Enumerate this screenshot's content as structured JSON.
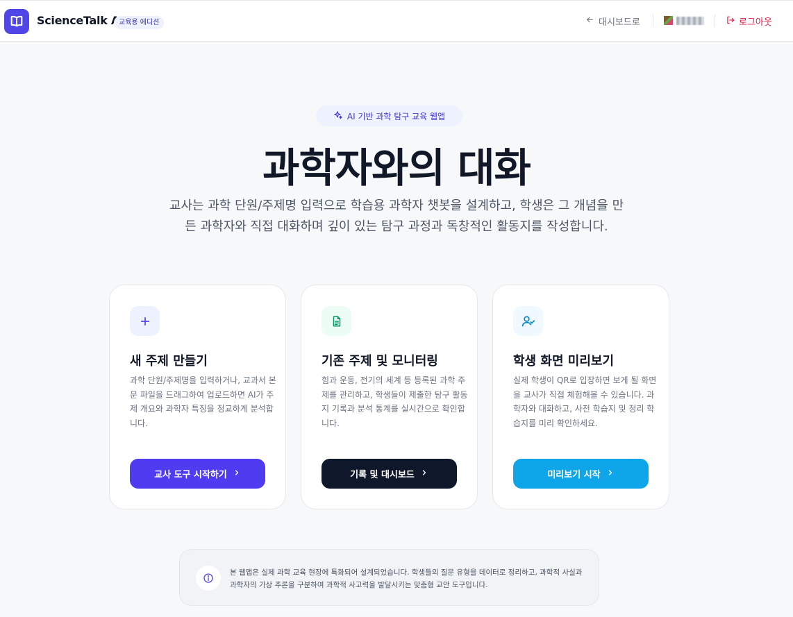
{
  "header": {
    "app_title": "ScienceTalk AI",
    "edition_badge": "교육용 에디션",
    "dashboard_link": "대시보드로",
    "logout": "로그아웃"
  },
  "hero": {
    "pill": "AI 기반 과학 탐구 교육 웹앱",
    "title": "과학자와의 대화",
    "description": "교사는 과학 단원/주제명 입력으로 학습용 과학자 챗봇을 설계하고, 학생은 그 개념을 만든 과학자와 직접 대화하며 깊이 있는 탐구 과정과 독창적인 활동지를 작성합니다."
  },
  "cards": [
    {
      "icon": "plus-icon",
      "title": "새 주제 만들기",
      "description": "과학 단원/주제명을 입력하거나, 교과서 본문 파일을 드래그하여 업로드하면 AI가 주제 개요와 과학자 특징을 정교하게 분석합니다.",
      "button": "교사 도구 시작하기",
      "button_color": "#4f3cf0",
      "icon_bg": "#eef2ff",
      "icon_color": "#4f46e5"
    },
    {
      "icon": "document-icon",
      "title": "기존 주제 및 모니터링",
      "description": "힘과 운동, 전기의 세계 등 등록된 과학 주제를 관리하고, 학생들이 제출한 탐구 활동지 기록과 분석 통계를 실시간으로 확인합니다.",
      "button": "기록 및 대시보드",
      "button_color": "#0f172a",
      "icon_bg": "#ecfdf5",
      "icon_color": "#059669"
    },
    {
      "icon": "user-check-icon",
      "title": "학생 화면 미리보기",
      "description": "실제 학생이 QR로 입장하면 보게 될 화면을 교사가 직접 체험해볼 수 있습니다. 과학자와 대화하고, 사전 학습지 및 정리 학습지를 미리 확인하세요.",
      "button": "미리보기 시작",
      "button_color": "#0ea5e9",
      "icon_bg": "#f0f9ff",
      "icon_color": "#0284c7"
    }
  ],
  "info": {
    "icon": "info-icon",
    "text": "본 웹앱은 실제 과학 교육 현장에 특화되어 설계되었습니다. 학생들의 질문 유형을 데이터로 정리하고, 과학적 사실과 과학자의 가상 추론을 구분하여 과학적 사고력을 발달시키는 맞춤형 교안 도구입니다."
  },
  "colors": {
    "accent": "#4f46e5",
    "logout": "#e11d48",
    "background": "#f7f8fa"
  }
}
